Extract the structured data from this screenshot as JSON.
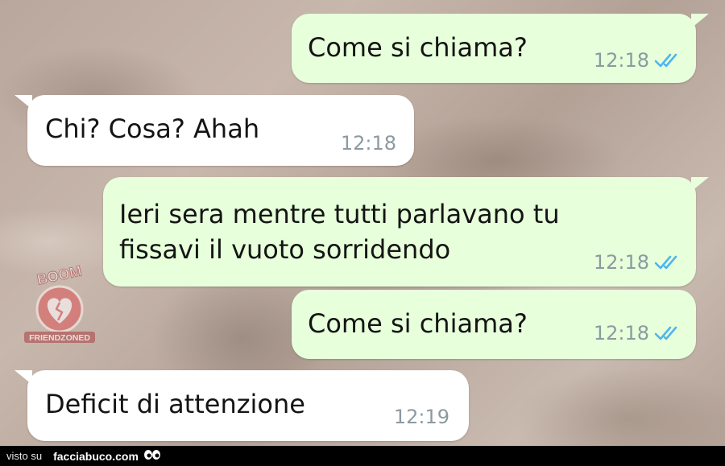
{
  "messages": [
    {
      "direction": "out",
      "text": "Come si chiama?",
      "time": "12:18",
      "status_icon": "double-check-read-icon"
    },
    {
      "direction": "in",
      "text": "Chi? Cosa? Ahah",
      "time": "12:18"
    },
    {
      "direction": "out",
      "text": "Ieri sera mentre tutti parlavano tu\nfissavi il vuoto sorridendo",
      "time": "12:18",
      "status_icon": "double-check-read-icon"
    },
    {
      "direction": "out",
      "text": "Come si chiama?",
      "time": "12:18",
      "status_icon": "double-check-read-icon"
    },
    {
      "direction": "in",
      "text": "Deficit di attenzione",
      "time": "12:19"
    }
  ],
  "watermark": {
    "top_text": "BOOM",
    "bottom_text": "FRIENDZONED",
    "icon": "broken-heart-icon"
  },
  "footer": {
    "prefix": "visto su",
    "site": "facciabuco.com",
    "icon": "eyes-icon"
  },
  "colors": {
    "outgoing_bubble": "#e7ffdb",
    "incoming_bubble": "#ffffff",
    "read_ticks": "#4fb6ec",
    "timestamp": "#8c9aa0"
  }
}
